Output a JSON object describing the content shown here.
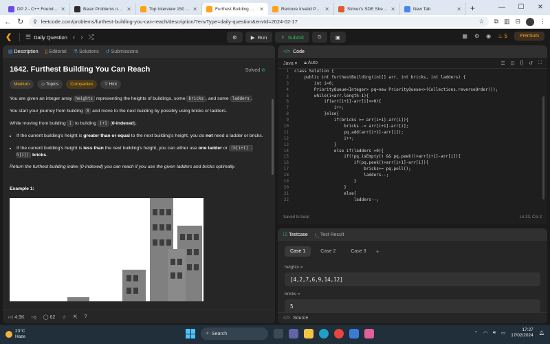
{
  "browser": {
    "tabs": [
      {
        "title": "DP 2 - C++ Foundation",
        "color": "#6b4ce6"
      },
      {
        "title": "Basic Problems on DP",
        "color": "#2b2b2b"
      },
      {
        "title": "Top Interview 150 - St",
        "color": "#ffa116"
      },
      {
        "title": "Furthest Building You C",
        "color": "#ffa116"
      },
      {
        "title": "Remove Invalid Parent",
        "color": "#ffa116"
      },
      {
        "title": "Striver's SDE Sheet - T",
        "color": "#e05a2b"
      },
      {
        "title": "New Tab",
        "color": "#4a86e8"
      }
    ],
    "url": "leetcode.com/problems/furthest-building-you-can-reach/description/?envType=daily-question&envId=2024-02-17"
  },
  "toolbar": {
    "daily_label": "Daily Question",
    "run_label": "Run",
    "submit_label": "Submit",
    "streak": "5",
    "premium_label": "Premium"
  },
  "left_tabs": [
    "Description",
    "Editorial",
    "Solutions",
    "Submissions"
  ],
  "problem": {
    "title": "1642. Furthest Building You Can Reach",
    "solved_label": "Solved",
    "tags": [
      "Medium",
      "Topics",
      "Companies",
      "Hint"
    ],
    "p1_a": "You are given an integer array ",
    "p1_code1": "heights",
    "p1_b": " representing the heights of buildings, some ",
    "p1_code2": "bricks",
    "p1_c": ", and some ",
    "p1_code3": "ladders",
    "p1_d": ".",
    "p2_a": "You start your journey from building ",
    "p2_code": "0",
    "p2_b": " and move to the next building by possibly using bricks or ladders.",
    "p3_a": "While moving from building ",
    "p3_code1": "i",
    "p3_b": " to building ",
    "p3_code2": "i+1",
    "p3_c": " (",
    "p3_bold": "0-indexed",
    "p3_d": "),",
    "li1_a": "If the current building's height is ",
    "li1_bold": "greater than or equal",
    "li1_b": " to the next building's height, you do ",
    "li1_bold2": "not",
    "li1_c": " need a ladder or bricks.",
    "li2_a": "If the current building's height is ",
    "li2_bold": "less than",
    "li2_b": " the next building's height, you can either use ",
    "li2_bold2": "one ladder",
    "li2_c": " or ",
    "li2_code": "(h[i+1] - h[i])",
    "li2_d": " ",
    "li2_bold3": "bricks",
    "li2_e": ".",
    "return_text": "Return the furthest building index (0-indexed) you can reach if you use the given ladders and bricks optimally.",
    "example_title": "Example 1:"
  },
  "left_footer": {
    "likes": "4.9K",
    "comments": "62"
  },
  "code": {
    "header": "Code",
    "language": "Java",
    "mode": "Auto",
    "lines": [
      "class Solution {",
      "    public int furthestBuilding(int[] arr, int bricks, int ladders) {",
      "        int i=0;",
      "        PriorityQueue<Integer> pq=new PriorityQueue<>(Collections.reverseOrder());",
      "        while(i<arr.length-1){",
      "            if(arr[i+1]-arr[i]<=0){",
      "                i++;",
      "            }else{",
      "                if(bricks >= arr[i+1]-arr[i]){",
      "                    bricks -= arr[i+1]-arr[i];",
      "                    pq.add(arr[i+1]-arr[i]);",
      "                    i++;",
      "                }",
      "                else if(ladders >0){",
      "                    if(!pq.isEmpty() && pq.peek()>arr[i+1]-arr[i]){",
      "                        if(pq.peek()>arr[i+1]-arr[i]){",
      "                            bricks+= pq.poll();",
      "                            ladders--;",
      "                        }",
      "                    }",
      "                    else{",
      "                        ladders--;"
    ],
    "saved_label": "Saved to local",
    "cursor_pos": "Ln 33, Col 2"
  },
  "testcase": {
    "tab_testcase": "Testcase",
    "tab_result": "Test Result",
    "cases": [
      "Case 1",
      "Case 2",
      "Case 3"
    ],
    "heights_label": "heights =",
    "heights_value": "[4,2,7,6,9,14,12]",
    "bricks_label": "bricks =",
    "bricks_value": "5",
    "source_label": "Source"
  },
  "taskbar": {
    "temp": "23°C",
    "weather": "Haze",
    "search": "Search",
    "lang": "ENG\nIN",
    "time": "17:27",
    "date": "17/02/2024"
  }
}
